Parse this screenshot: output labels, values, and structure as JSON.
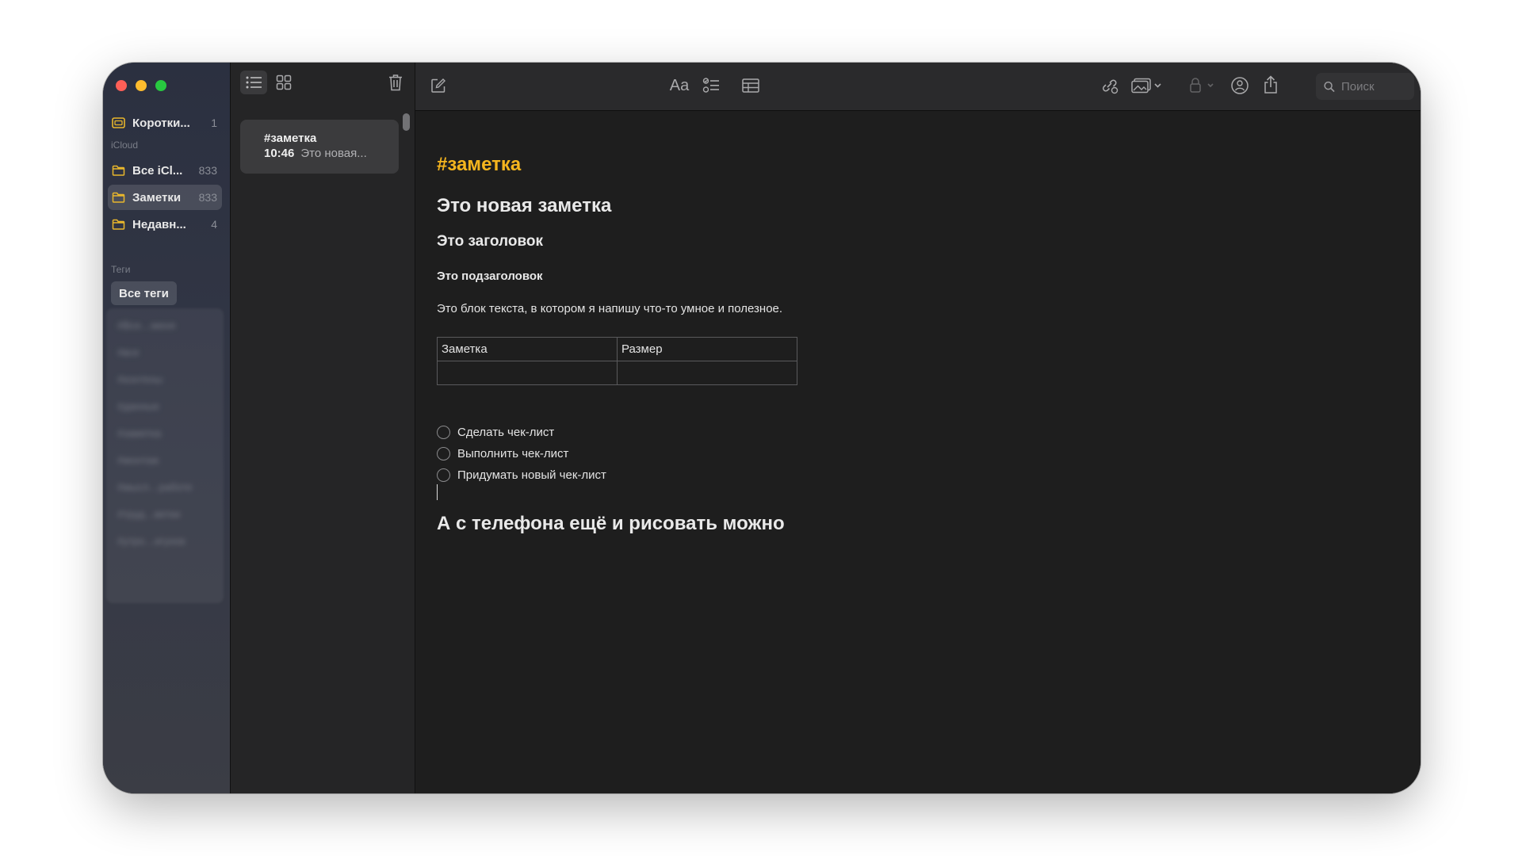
{
  "window": {
    "traffic_lights": [
      "close",
      "minimize",
      "zoom"
    ]
  },
  "colors": {
    "accent": "#f5b51e",
    "folder": "#e8b62c"
  },
  "sidebar": {
    "quick_note": {
      "label": "Коротки...",
      "count": "1"
    },
    "icloud_section": "iCloud",
    "folders": [
      {
        "label": "Все iCl...",
        "count": "833"
      },
      {
        "label": "Заметки",
        "count": "833"
      },
      {
        "label": "Недавн...",
        "count": "4"
      }
    ],
    "tags_section": "Теги",
    "all_tags": "Все теги",
    "blurred_tags": [
      "#Все…меня",
      "#все",
      "#контены",
      "#данные",
      "#заметка",
      "#монтаж",
      "#мысл…работе",
      "#труд…ветки",
      "#утро…игунок"
    ]
  },
  "note_list": {
    "items": [
      {
        "title": "#заметка",
        "time": "10:46",
        "preview": "Это новая..."
      }
    ]
  },
  "toolbar": {
    "format_label": "Aa",
    "search_placeholder": "Поиск"
  },
  "note": {
    "hashtag": "#заметка",
    "title": "Это новая заметка",
    "heading": "Это заголовок",
    "subheading": "Это подзаголовок",
    "body": "Это блок текста, в котором я напишу что-то умное и полезное.",
    "table": {
      "headers": [
        "Заметка",
        "Размер"
      ],
      "rows": [
        [
          "",
          ""
        ]
      ]
    },
    "checklist": [
      "Сделать чек-лист",
      "Выполнить чек-лист",
      "Придумать новый чек-лист"
    ],
    "footer_heading": "А с телефона ещё и рисовать можно"
  }
}
